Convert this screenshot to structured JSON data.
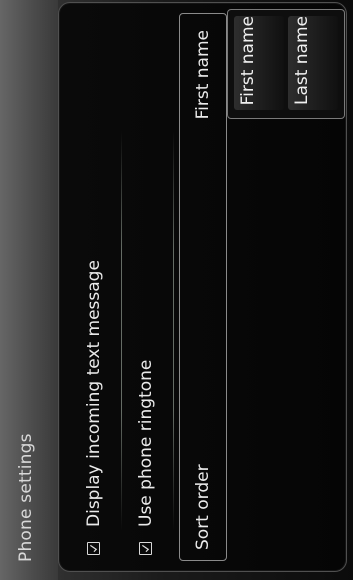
{
  "header": {
    "title": "Phone settings"
  },
  "settings": {
    "display_incoming_text": {
      "label": "Display incoming text message",
      "checked": true,
      "icon": "checkbox-checked-icon"
    },
    "use_phone_ringtone": {
      "label": "Use phone ringtone",
      "checked": true,
      "icon": "checkbox-checked-icon"
    },
    "sort_order": {
      "label": "Sort order",
      "value": "First name",
      "options": [
        "First name",
        "Last name"
      ]
    }
  },
  "colors": {
    "title_bar": "#4a4a4a",
    "panel_border": "#505050",
    "text": "#eaeaea",
    "background": "#050505"
  }
}
